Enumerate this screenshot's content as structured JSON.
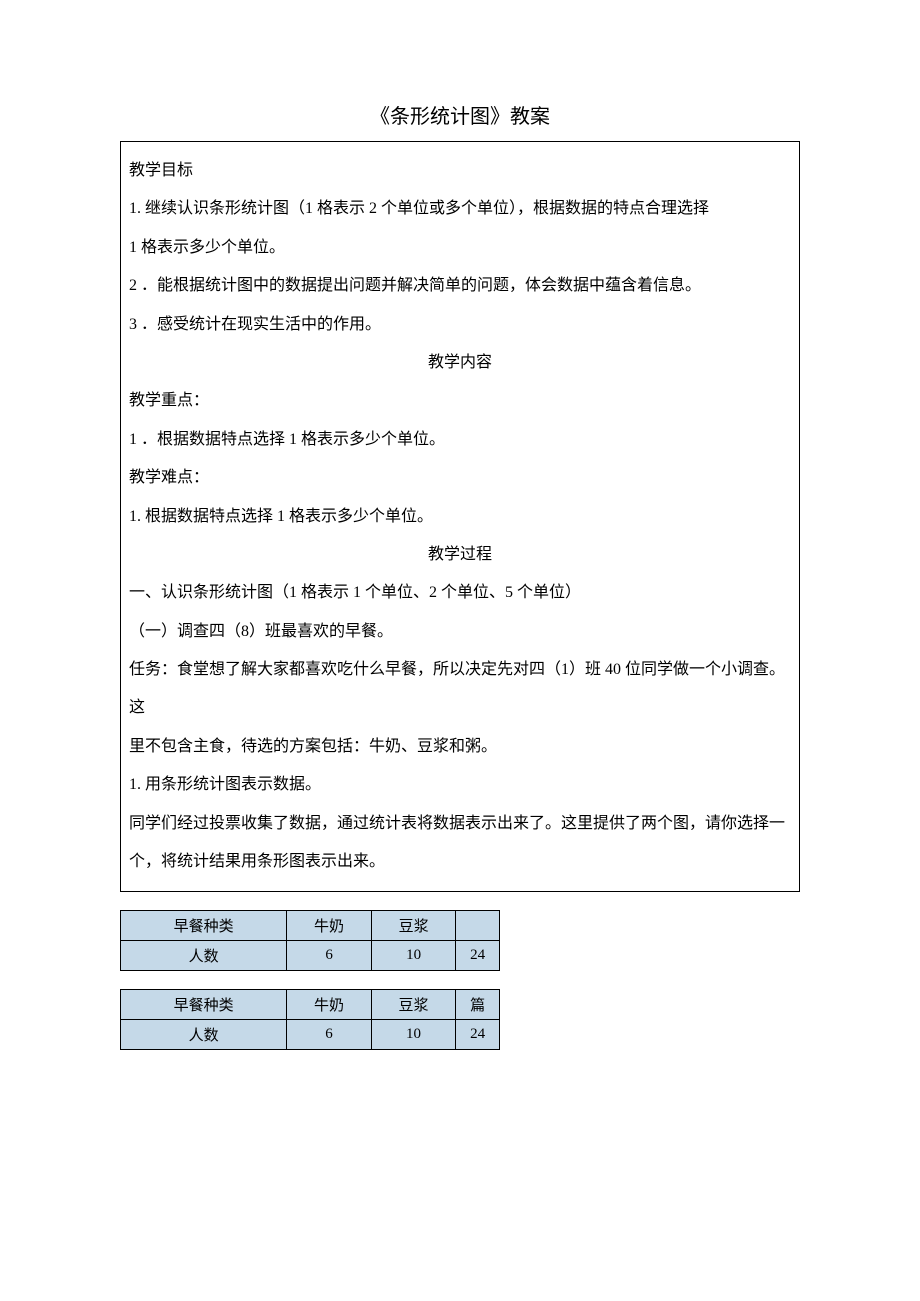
{
  "title": "《条形统计图》教案",
  "section1": {
    "heading": "教学目标",
    "items": [
      "1. 继续认识条形统计图（1 格表示 2 个单位或多个单位），根据数据的特点合理选择",
      "1 格表示多少个单位。",
      "2 ．能根据统计图中的数据提出问题并解决简单的问题，体会数据中蕴含着信息。",
      "3 ．感受统计在现实生活中的作用。"
    ]
  },
  "section2": {
    "heading": "教学内容",
    "sub1": "教学重点：",
    "sub1_item": "1 ．根据数据特点选择 1 格表示多少个单位。",
    "sub2": "教学难点：",
    "sub2_item": "1. 根据数据特点选择 1 格表示多少个单位。"
  },
  "section3": {
    "heading": "教学过程",
    "lines": [
      "一、认识条形统计图（1 格表示 1 个单位、2 个单位、5 个单位）",
      "（一）调查四（8）班最喜欢的早餐。",
      "任务：食堂想了解大家都喜欢吃什么早餐，所以决定先对四（1）班 40 位同学做一个小调查。这",
      "里不包含主食，待选的方案包括：牛奶、豆浆和粥。",
      "1. 用条形统计图表示数据。",
      "同学们经过投票收集了数据，通过统计表将数据表示出来了。这里提供了两个图，请你选择一",
      "个，将统计结果用条形图表示出来。"
    ]
  },
  "table1": {
    "row1": [
      "早餐种类",
      "牛奶",
      "豆浆",
      ""
    ],
    "row2": [
      "人数",
      "6",
      "10",
      "24"
    ]
  },
  "table2": {
    "row1": [
      "早餐种类",
      "牛奶",
      "豆浆",
      "篇"
    ],
    "row2": [
      "人数",
      "6",
      "10",
      "24"
    ]
  }
}
